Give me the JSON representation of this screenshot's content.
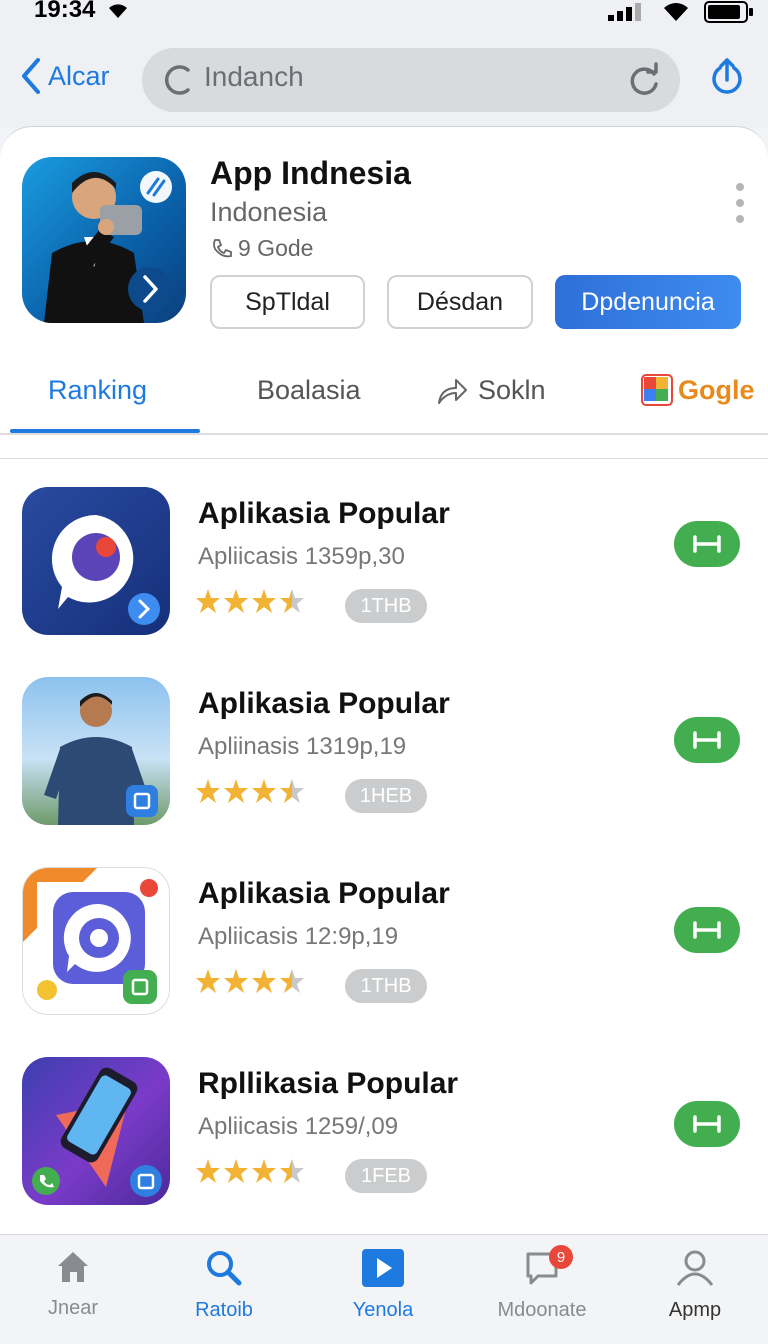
{
  "status_bar": {
    "time": "19:34"
  },
  "nav": {
    "back_label": "Alcar",
    "search_value": "Indanch"
  },
  "app": {
    "title": "App Indnesia",
    "subtitle": "Indonesia",
    "meta": "9 Gode",
    "buttons": [
      "SpTldal",
      "Désdan",
      "Dpdenuncia"
    ]
  },
  "tabs": [
    {
      "label": "Ranking",
      "active": true
    },
    {
      "label": "Boalasia",
      "active": false
    },
    {
      "label": "Sokln",
      "active": false
    },
    {
      "label": "Gogle",
      "active": false
    }
  ],
  "list": [
    {
      "title": "Aplikasia Popular",
      "subtitle": "Apliicasis  1359p,30",
      "rating": 3.5,
      "badge": "1THB",
      "icon": "chat-bubble-icon"
    },
    {
      "title": "Aplikasia Popular",
      "subtitle": "Apliinasis  1319p,19",
      "rating": 3.5,
      "badge": "1HEB",
      "icon": "person-photo-icon"
    },
    {
      "title": "Aplikasia Popular",
      "subtitle": "Apliicasis  12:9p,19",
      "rating": 3.5,
      "badge": "1THB",
      "icon": "camera-chat-icon"
    },
    {
      "title": "Rpllikasia Popular",
      "subtitle": "Apliicasis  1259/,09",
      "rating": 3.5,
      "badge": "1FEB",
      "icon": "phone-app-icon"
    }
  ],
  "tabbar": [
    {
      "label": "Jnear",
      "icon": "home-icon"
    },
    {
      "label": "Ratoib",
      "icon": "search-icon",
      "active": true
    },
    {
      "label": "Yenola",
      "icon": "play-icon",
      "active": true
    },
    {
      "label": "Mdoonate",
      "icon": "chat-icon",
      "badge": "9"
    },
    {
      "label": "Apmp",
      "icon": "profile-icon",
      "dark": true
    }
  ],
  "colors": {
    "accent": "#1f7ae0",
    "primary_button": "#3478e0",
    "get_button": "#43ae4f",
    "star": "#f2b233",
    "badge": "#e8473a"
  }
}
